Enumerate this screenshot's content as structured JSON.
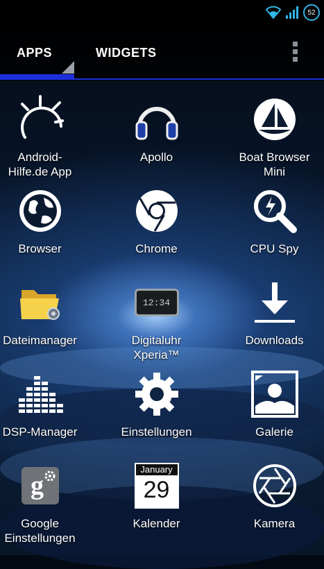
{
  "status_bar": {
    "battery_level": "52",
    "icons": [
      "wifi-icon",
      "signal-icon",
      "battery-icon"
    ]
  },
  "tabs": [
    {
      "label": "APPS",
      "selected": true
    },
    {
      "label": "WIDGETS",
      "selected": false
    }
  ],
  "colors": {
    "accent": "#1d2fdc",
    "status_accent": "#33b5e5"
  },
  "apps": [
    {
      "label": "Android-\nHilfe.de App",
      "icon": "android-hilfe-icon"
    },
    {
      "label": "Apollo",
      "icon": "headphones-icon"
    },
    {
      "label": "Boat Browser\nMini",
      "icon": "boat-icon"
    },
    {
      "label": "Browser",
      "icon": "globe-icon"
    },
    {
      "label": "Chrome",
      "icon": "chrome-icon"
    },
    {
      "label": "CPU Spy",
      "icon": "cpu-spy-icon"
    },
    {
      "label": "Dateimanager",
      "icon": "folder-icon"
    },
    {
      "label": "Digitaluhr\nXperia™",
      "icon": "clock-icon",
      "clock_time": "12:34"
    },
    {
      "label": "Downloads",
      "icon": "download-icon"
    },
    {
      "label": "DSP-Manager",
      "icon": "equalizer-icon"
    },
    {
      "label": "Einstellungen",
      "icon": "gear-icon"
    },
    {
      "label": "Galerie",
      "icon": "gallery-icon"
    },
    {
      "label": "Google\nEinstellungen",
      "icon": "google-settings-icon"
    },
    {
      "label": "Kalender",
      "icon": "calendar-icon",
      "month": "January",
      "day": "29"
    },
    {
      "label": "Kamera",
      "icon": "camera-icon"
    }
  ]
}
